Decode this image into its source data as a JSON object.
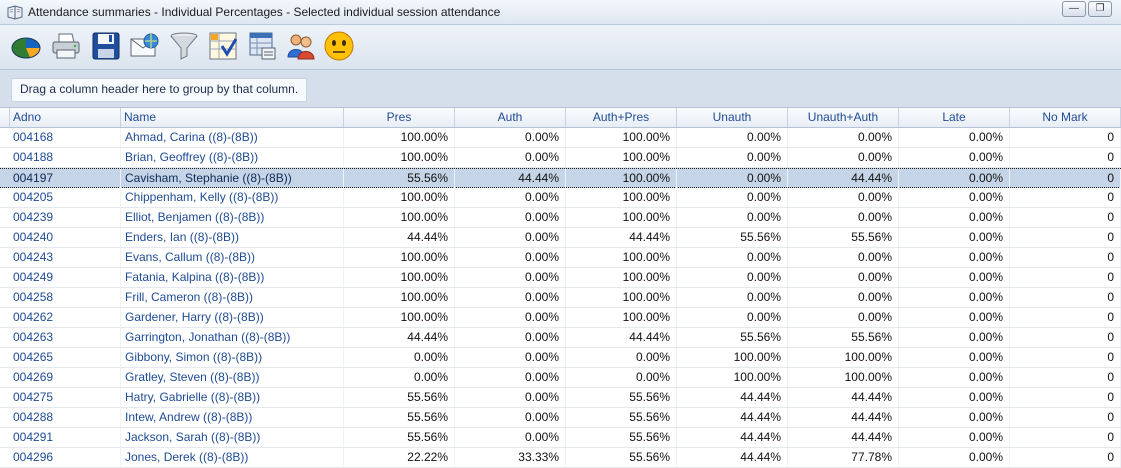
{
  "window": {
    "title": "Attendance summaries - Individual Percentages - Selected individual session attendance",
    "minimize_glyph": "—",
    "restore_glyph": "❐"
  },
  "toolbar": {
    "buttons": [
      {
        "icon": "chart-icon"
      },
      {
        "icon": "printer-icon"
      },
      {
        "icon": "save-icon"
      },
      {
        "icon": "email-icon"
      },
      {
        "icon": "filter-icon"
      },
      {
        "icon": "checklist-icon"
      },
      {
        "icon": "table-settings-icon"
      },
      {
        "icon": "users-icon"
      },
      {
        "icon": "smiley-icon"
      }
    ]
  },
  "group_bar": {
    "hint": "Drag a column header here to group by that column."
  },
  "grid": {
    "columns": [
      "Adno",
      "Name",
      "Pres",
      "Auth",
      "Auth+Pres",
      "Unauth",
      "Unauth+Auth",
      "Late",
      "No Mark"
    ],
    "selected_row": 2,
    "rows": [
      [
        "004168",
        "Ahmad, Carina ((8)-(8B))",
        "100.00%",
        "0.00%",
        "100.00%",
        "0.00%",
        "0.00%",
        "0.00%",
        "0"
      ],
      [
        "004188",
        "Brian, Geoffrey ((8)-(8B))",
        "100.00%",
        "0.00%",
        "100.00%",
        "0.00%",
        "0.00%",
        "0.00%",
        "0"
      ],
      [
        "004197",
        "Cavisham, Stephanie ((8)-(8B))",
        "55.56%",
        "44.44%",
        "100.00%",
        "0.00%",
        "44.44%",
        "0.00%",
        "0"
      ],
      [
        "004205",
        "Chippenham, Kelly ((8)-(8B))",
        "100.00%",
        "0.00%",
        "100.00%",
        "0.00%",
        "0.00%",
        "0.00%",
        "0"
      ],
      [
        "004239",
        "Elliot, Benjamen ((8)-(8B))",
        "100.00%",
        "0.00%",
        "100.00%",
        "0.00%",
        "0.00%",
        "0.00%",
        "0"
      ],
      [
        "004240",
        "Enders, Ian ((8)-(8B))",
        "44.44%",
        "0.00%",
        "44.44%",
        "55.56%",
        "55.56%",
        "0.00%",
        "0"
      ],
      [
        "004243",
        "Evans, Callum ((8)-(8B))",
        "100.00%",
        "0.00%",
        "100.00%",
        "0.00%",
        "0.00%",
        "0.00%",
        "0"
      ],
      [
        "004249",
        "Fatania, Kalpina ((8)-(8B))",
        "100.00%",
        "0.00%",
        "100.00%",
        "0.00%",
        "0.00%",
        "0.00%",
        "0"
      ],
      [
        "004258",
        "Frill, Cameron ((8)-(8B))",
        "100.00%",
        "0.00%",
        "100.00%",
        "0.00%",
        "0.00%",
        "0.00%",
        "0"
      ],
      [
        "004262",
        "Gardener, Harry ((8)-(8B))",
        "100.00%",
        "0.00%",
        "100.00%",
        "0.00%",
        "0.00%",
        "0.00%",
        "0"
      ],
      [
        "004263",
        "Garrington, Jonathan ((8)-(8B))",
        "44.44%",
        "0.00%",
        "44.44%",
        "55.56%",
        "55.56%",
        "0.00%",
        "0"
      ],
      [
        "004265",
        "Gibbony, Simon ((8)-(8B))",
        "0.00%",
        "0.00%",
        "0.00%",
        "100.00%",
        "100.00%",
        "0.00%",
        "0"
      ],
      [
        "004269",
        "Gratley, Steven ((8)-(8B))",
        "0.00%",
        "0.00%",
        "0.00%",
        "100.00%",
        "100.00%",
        "0.00%",
        "0"
      ],
      [
        "004275",
        "Hatry, Gabrielle ((8)-(8B))",
        "55.56%",
        "0.00%",
        "55.56%",
        "44.44%",
        "44.44%",
        "0.00%",
        "0"
      ],
      [
        "004288",
        "Intew, Andrew ((8)-(8B))",
        "55.56%",
        "0.00%",
        "55.56%",
        "44.44%",
        "44.44%",
        "0.00%",
        "0"
      ],
      [
        "004291",
        "Jackson, Sarah ((8)-(8B))",
        "55.56%",
        "0.00%",
        "55.56%",
        "44.44%",
        "44.44%",
        "0.00%",
        "0"
      ],
      [
        "004296",
        "Jones, Derek ((8)-(8B))",
        "22.22%",
        "33.33%",
        "55.56%",
        "44.44%",
        "77.78%",
        "0.00%",
        "0"
      ]
    ]
  }
}
